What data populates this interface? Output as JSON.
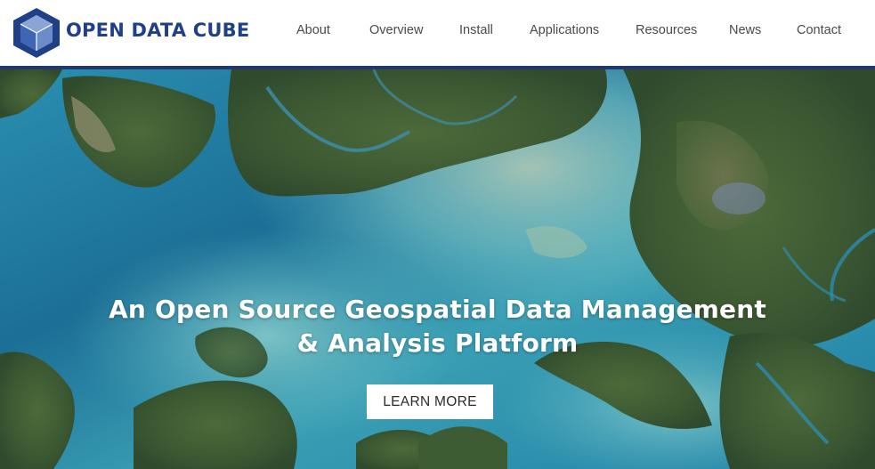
{
  "brand": {
    "name": "OPEN DATA CUBE",
    "logo_icon": "cube-hexagon-icon",
    "color": "#1f3f87"
  },
  "nav": {
    "items": [
      {
        "label": "About"
      },
      {
        "label": "Overview"
      },
      {
        "label": "Install"
      },
      {
        "label": "Applications"
      },
      {
        "label": "Resources"
      },
      {
        "label": "News"
      },
      {
        "label": "Contact"
      }
    ]
  },
  "hero": {
    "title_line1": "An Open Source Geospatial Data Management",
    "title_line2": "& Analysis Platform",
    "cta_label": "LEARN MORE",
    "image_icon": "satellite-coastline-image"
  },
  "colors": {
    "header_rule": "#22386a",
    "water_deep": "#1a6f93",
    "water_shallow": "#5fb8c2",
    "land": "#3e5c33"
  }
}
